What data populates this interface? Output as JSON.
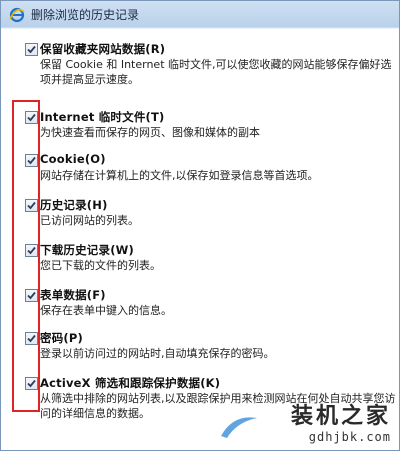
{
  "window": {
    "title": "删除浏览的历史记录",
    "title_icon": "ie-icon"
  },
  "options": [
    {
      "label": "保留收藏夹网站数据(R)",
      "description": "保留 Cookie 和 Internet 临时文件,可以使您收藏的网站能够保存偏好选项并提高显示速度。",
      "checked": true
    },
    {
      "label": "Internet 临时文件(T)",
      "description": "为快速查看而保存的网页、图像和媒体的副本",
      "checked": true
    },
    {
      "label": "Cookie(O)",
      "description": "网站存储在计算机上的文件,以保存如登录信息等首选项。",
      "checked": true
    },
    {
      "label": "历史记录(H)",
      "description": "已访问网站的列表。",
      "checked": true
    },
    {
      "label": "下载历史记录(W)",
      "description": "您已下载的文件的列表。",
      "checked": true
    },
    {
      "label": "表单数据(F)",
      "description": "保存在表单中键入的信息。",
      "checked": true
    },
    {
      "label": "密码(P)",
      "description": "登录以前访问过的网站时,自动填充保存的密码。",
      "checked": true
    },
    {
      "label": "ActiveX 筛选和跟踪保护数据(K)",
      "description": "从筛选中排除的网站列表,以及跟踪保护用来检测网站在何处自动共享您访问的详细信息的数据。",
      "checked": true
    }
  ],
  "watermark": {
    "logo": "装机之家",
    "url": "gdhjbk.com"
  },
  "colors": {
    "highlight": "#e02424",
    "titlebar": "#b9d1ea"
  }
}
